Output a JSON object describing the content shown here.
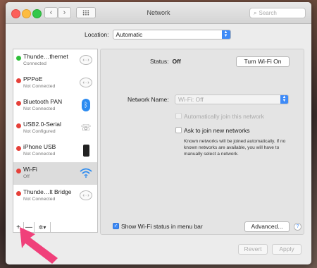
{
  "window": {
    "title": "Network"
  },
  "toolbar": {
    "back": "‹",
    "forward": "›",
    "search_placeholder": "Search"
  },
  "location": {
    "label": "Location:",
    "value": "Automatic"
  },
  "sidebar": {
    "items": [
      {
        "name": "Thunde…thernet",
        "status": "Connected",
        "dot": "#2fbf3a",
        "icon": "arrows-icon"
      },
      {
        "name": "PPPoE",
        "status": "Not Connected",
        "dot": "#e6413a",
        "icon": "arrows-icon"
      },
      {
        "name": "Bluetooth PAN",
        "status": "Not Connected",
        "dot": "#e6413a",
        "icon": "bluetooth-icon"
      },
      {
        "name": "USB2.0-Serial",
        "status": "Not Configured",
        "dot": "#e6413a",
        "icon": "phone-modem-icon"
      },
      {
        "name": "iPhone USB",
        "status": "Not Connected",
        "dot": "#e6413a",
        "icon": "iphone-icon"
      },
      {
        "name": "Wi-Fi",
        "status": "Off",
        "dot": "#e6413a",
        "icon": "wifi-icon"
      },
      {
        "name": "Thunde…lt Bridge",
        "status": "Not Connected",
        "dot": "#e6413a",
        "icon": "arrows-icon"
      }
    ],
    "tools": {
      "add": "+",
      "remove": "—",
      "action": "✲▾"
    }
  },
  "pane": {
    "status_label": "Status:",
    "status_value": "Off",
    "turn_on_button": "Turn Wi-Fi On",
    "network_name_label": "Network Name:",
    "network_name_value": "Wi-Fi: Off",
    "auto_join_label": "Automatically join this network",
    "ask_join_label": "Ask to join new networks",
    "ask_join_note": "Known networks will be joined automatically. If no known networks are available, you will have to manually select a network.",
    "show_status_label": "Show Wi-Fi status in menu bar",
    "advanced_button": "Advanced...",
    "help": "?"
  },
  "footer": {
    "revert": "Revert",
    "apply": "Apply"
  },
  "colors": {
    "accent": "#3d8af7",
    "pointer": "#f0407a"
  }
}
